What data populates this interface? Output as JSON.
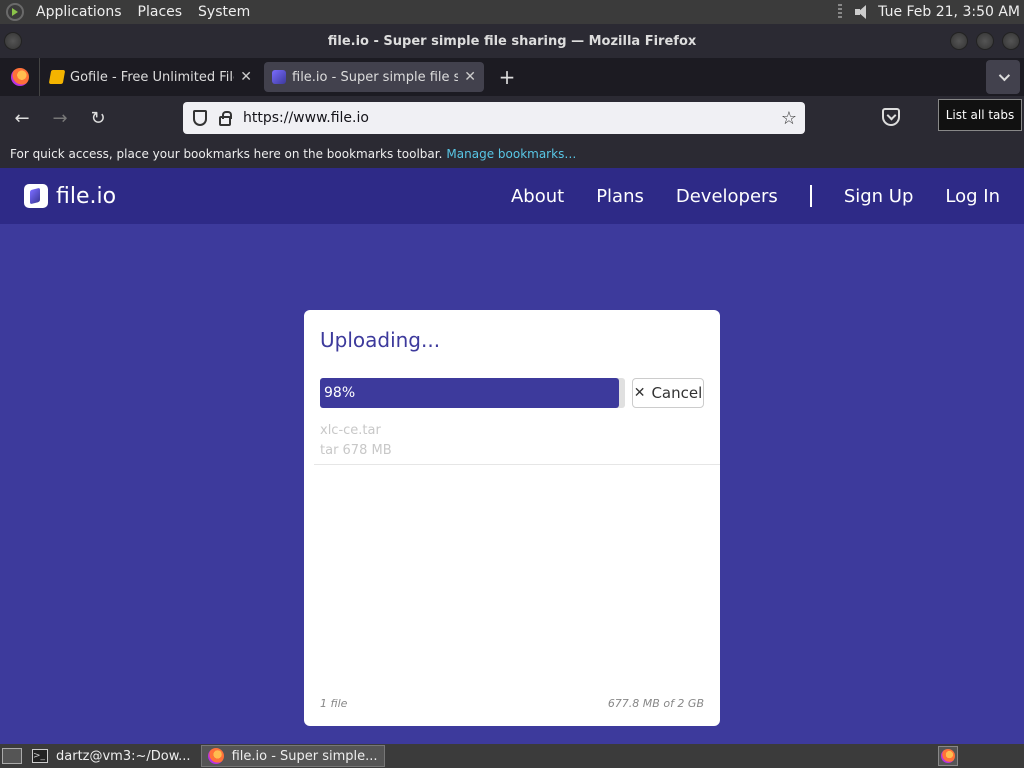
{
  "top_panel": {
    "menus": [
      "Applications",
      "Places",
      "System"
    ],
    "clock": "Tue Feb 21,  3:50 AM"
  },
  "window": {
    "title": "file.io - Super simple file sharing — Mozilla Firefox"
  },
  "tabs": [
    {
      "label": "Gofile - Free Unlimited File Sharing",
      "active": false,
      "favicon": "gofile-icon"
    },
    {
      "label": "file.io - Super simple file sharing",
      "active": true,
      "favicon": "fileio-icon"
    }
  ],
  "navbar": {
    "url": "https://www.file.io",
    "list_tabs_tooltip": "List all tabs"
  },
  "bookmarks_bar": {
    "message": "For quick access, place your bookmarks here on the bookmarks toolbar.",
    "link": "Manage bookmarks…"
  },
  "site": {
    "logo_text": "file.io",
    "nav": [
      "About",
      "Plans",
      "Developers",
      "Sign Up",
      "Log In"
    ],
    "accent": "#3d3a9c"
  },
  "upload": {
    "title": "Uploading...",
    "progress_percent": 98,
    "progress_text": "98%",
    "cancel_label": "Cancel",
    "file_name": "xlc-ce.tar",
    "file_meta": "tar 678 MB",
    "file_count": "1 file",
    "size_total": "677.8 MB of 2 GB"
  },
  "taskbar": {
    "tasks": [
      "dartz@vm3:~/Dow...",
      "file.io - Super simple..."
    ]
  }
}
